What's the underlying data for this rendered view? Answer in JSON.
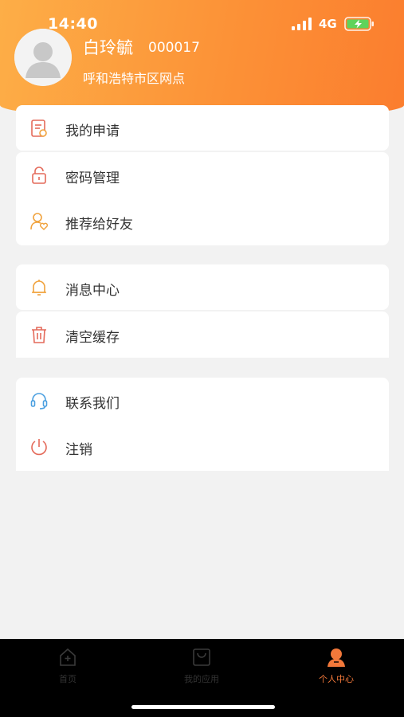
{
  "status_bar": {
    "time": "14:40",
    "network": "4G"
  },
  "profile": {
    "name": "白玲毓",
    "id": "000017",
    "branch": "呼和浩特市区网点"
  },
  "menu": {
    "my_application": "我的申请",
    "password_management": "密码管理",
    "recommend_to_friend": "推荐给好友",
    "message_center": "消息中心",
    "clear_cache": "清空缓存",
    "contact_us": "联系我们",
    "logout": "注销"
  },
  "tabbar": {
    "home": "首页",
    "my_apps": "我的应用",
    "personal_center": "个人中心",
    "active_color": "#f2783a"
  },
  "colors": {
    "header_gradient_start": "#fdae47",
    "header_gradient_end": "#fb7d2e",
    "icon_red": "#e46a5a",
    "icon_orange": "#f0a23c",
    "icon_blue": "#4a9fe0"
  }
}
